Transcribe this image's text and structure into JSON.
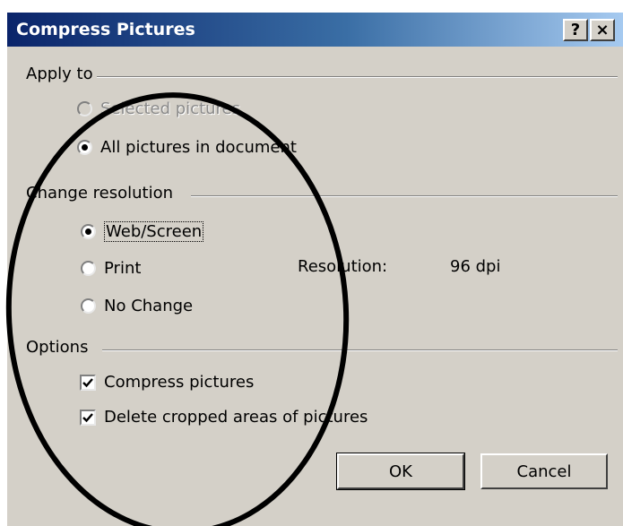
{
  "window": {
    "title": "Compress Pictures",
    "help_label": "?",
    "close_label": "×"
  },
  "apply_to": {
    "label": "Apply to",
    "selected": {
      "label": "Selected pictures",
      "checked": false,
      "enabled": false
    },
    "all": {
      "label": "All pictures in document",
      "checked": true,
      "enabled": true
    }
  },
  "change_resolution": {
    "label": "Change resolution",
    "web": {
      "label": "Web/Screen",
      "checked": true
    },
    "print": {
      "label": "Print",
      "checked": false
    },
    "nochange": {
      "label": "No Change",
      "checked": false
    },
    "resolution_label": "Resolution:",
    "resolution_value": "96 dpi"
  },
  "options": {
    "label": "Options",
    "compress": {
      "label": "Compress pictures",
      "checked": true
    },
    "delete": {
      "label": "Delete cropped areas of pictures",
      "checked": true
    }
  },
  "buttons": {
    "ok": "OK",
    "cancel": "Cancel"
  },
  "colors": {
    "face": "#d4d0c8",
    "title_start": "#0a246a",
    "title_end": "#a6caf0",
    "annotation": "#000000"
  }
}
